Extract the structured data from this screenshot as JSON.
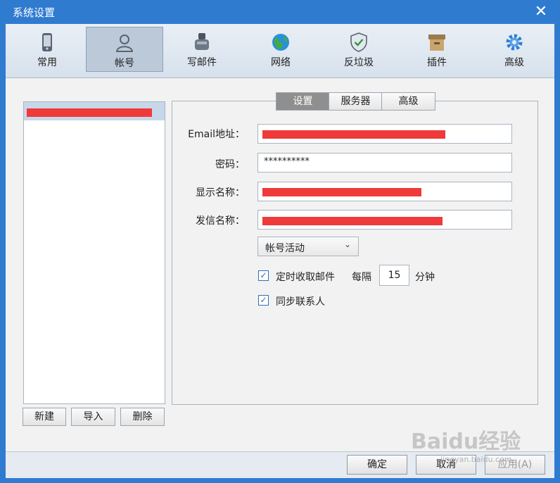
{
  "window": {
    "title": "系统设置",
    "close_glyph": "✕"
  },
  "toolbar": {
    "items": [
      {
        "label": "常用",
        "icon": "phone-icon"
      },
      {
        "label": "帐号",
        "icon": "person-icon"
      },
      {
        "label": "写邮件",
        "icon": "inkwell-icon"
      },
      {
        "label": "网络",
        "icon": "globe-icon"
      },
      {
        "label": "反垃圾",
        "icon": "shield-check-icon"
      },
      {
        "label": "插件",
        "icon": "box-icon"
      },
      {
        "label": "高级",
        "icon": "gear-icon"
      }
    ],
    "active_index": 1
  },
  "accounts": {
    "buttons": {
      "new": "新建",
      "import": "导入",
      "delete": "删除"
    }
  },
  "tabs": [
    "设置",
    "服务器",
    "高级"
  ],
  "form": {
    "email_label": "Email地址：",
    "password_label": "密码：",
    "password_value": "**********",
    "display_name_label": "显示名称：",
    "sender_name_label": "发信名称：",
    "account_status": "帐号活动",
    "timer_fetch_label": "定时收取邮件",
    "timer_fetch_checked": true,
    "every_label": "每隔",
    "interval_value": "15",
    "minutes_label": "分钟",
    "sync_contacts_label": "同步联系人",
    "sync_contacts_checked": true
  },
  "footer": {
    "ok": "确定",
    "cancel": "取消",
    "apply": "应用(A)"
  },
  "watermark": {
    "text": "Baidu经验",
    "sub": "jingyan.baidu.com"
  },
  "colors": {
    "titlebar": "#2f7bd0",
    "redaction": "#f03a3a",
    "check": "#2f6fb8"
  }
}
